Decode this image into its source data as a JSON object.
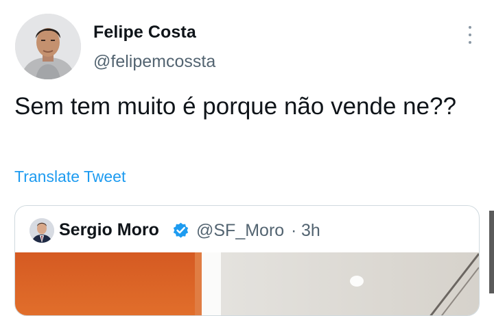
{
  "tweet": {
    "display_name": "Felipe Costa",
    "handle": "@felipemcossta",
    "text": "Sem tem muito é porque não vende ne??",
    "translate_label": "Translate Tweet"
  },
  "quoted_tweet": {
    "display_name": "Sergio Moro",
    "handle": "@SF_Moro",
    "separator": "·",
    "time": "3h",
    "verified": true
  },
  "icons": {
    "more": "more-options-icon",
    "verified": "verified-badge-icon"
  },
  "colors": {
    "link": "#1d9bf0",
    "secondary_text": "#536471",
    "border": "#cfd9de",
    "verified": "#1d9bf0"
  }
}
